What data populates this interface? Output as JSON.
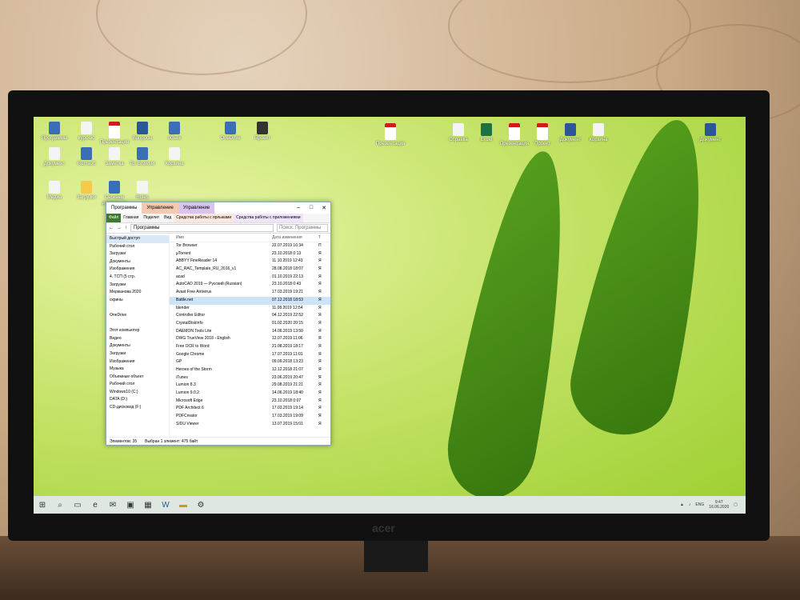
{
  "desktop_icons": [
    {
      "label": "Программы",
      "icon": "app-icon"
    },
    {
      "label": "курс-ас",
      "icon": "doc-icon"
    },
    {
      "label": "Презентация",
      "icon": "pdf-icon"
    },
    {
      "label": "Вопросы",
      "icon": "word-icon"
    },
    {
      "label": "объек",
      "icon": "app-icon"
    },
    {
      "label": "OneDrive",
      "icon": "app-icon"
    },
    {
      "label": "Проект",
      "icon": "dark-icon"
    },
    {
      "label": "Документ",
      "icon": "doc-icon"
    },
    {
      "label": "Remsoft",
      "icon": "app-icon"
    },
    {
      "label": "Заметка",
      "icon": "doc-icon"
    },
    {
      "label": "Tor Browser",
      "icon": "app-icon"
    },
    {
      "label": "Корзина",
      "icon": "doc-icon"
    },
    {
      "label": "Медиа",
      "icon": "doc-icon"
    },
    {
      "label": "Загрузки",
      "icon": "folder-icon"
    },
    {
      "label": "Сетевые документы",
      "icon": "app-icon"
    },
    {
      "label": "Rules",
      "icon": "doc-icon"
    },
    {
      "label": "Презентация",
      "icon": "pdf-icon"
    },
    {
      "label": "Документ",
      "icon": "word-icon"
    },
    {
      "label": "Excel",
      "icon": "excel-icon"
    },
    {
      "label": "Презентация",
      "icon": "pdf-icon"
    },
    {
      "label": "Проект",
      "icon": "pdf-icon"
    },
    {
      "label": "Документ",
      "icon": "word-icon"
    },
    {
      "label": "Корзина",
      "icon": "doc-icon"
    },
    {
      "label": "Справка",
      "icon": "doc-icon"
    }
  ],
  "explorer": {
    "title": "Программы",
    "context_tab_manage": "Управление",
    "context_tab_manage2": "Управление",
    "ribbon": [
      "Файл",
      "Главная",
      "Поделит",
      "Вид",
      "Средства работы с ярлыками",
      "Средства работы с приложениями"
    ],
    "path": "Программы",
    "search_placeholder": "Поиск: Программы",
    "column_name": "Имя",
    "column_date": "Дата изменения",
    "column_type": "Т",
    "nav": [
      {
        "label": "Быстрый доступ",
        "selected": true
      },
      {
        "label": "Рабочий стол"
      },
      {
        "label": "Загрузки"
      },
      {
        "label": "Документы"
      },
      {
        "label": "Изображения"
      },
      {
        "label": "4. ТСП (5 стр."
      },
      {
        "label": "Загрузки"
      },
      {
        "label": "Мержанова 2020"
      },
      {
        "label": "скрины"
      },
      {
        "label": ""
      },
      {
        "label": "OneDrive"
      },
      {
        "label": ""
      },
      {
        "label": "Этот компьютер"
      },
      {
        "label": "Видео"
      },
      {
        "label": "Документы"
      },
      {
        "label": "Загрузки"
      },
      {
        "label": "Изображения"
      },
      {
        "label": "Музыка"
      },
      {
        "label": "Объемные объект"
      },
      {
        "label": "Рабочий стол"
      },
      {
        "label": "Windows10 (C:)"
      },
      {
        "label": "DATA (D:)"
      },
      {
        "label": "CD-дисковод (F:)"
      }
    ],
    "files": [
      {
        "name": "Tor Browser",
        "date": "22.07.2019 16:34",
        "type": "П"
      },
      {
        "name": "µTorrent",
        "date": "23.10.2018 0:13",
        "type": "Я"
      },
      {
        "name": "ABBYY FineReader 14",
        "date": "11.10.2019 12:43",
        "type": "Я"
      },
      {
        "name": "AC_RAC_Template_RU_2016_v1",
        "date": "28.08.2018 18:07",
        "type": "Я"
      },
      {
        "name": "acad",
        "date": "01.10.2019 22:13",
        "type": "Я"
      },
      {
        "name": "AutoCAD 2019 — Русский (Russian)",
        "date": "23.10.2018 0:43",
        "type": "Я"
      },
      {
        "name": "Avast Free Antivirus",
        "date": "17.03.2019 19:21",
        "type": "Я"
      },
      {
        "name": "Battle.net",
        "date": "07.12.2018 18:53",
        "type": "Я",
        "selected": true
      },
      {
        "name": "blender",
        "date": "11.08.2019 12:54",
        "type": "Я"
      },
      {
        "name": "Controller Editor",
        "date": "04.12.2019 22:52",
        "type": "Я"
      },
      {
        "name": "CrystalDiskInfo",
        "date": "01.02.2020 20:15",
        "type": "Я"
      },
      {
        "name": "DAEMON Tools Lite",
        "date": "14.06.2019 13:50",
        "type": "Я"
      },
      {
        "name": "DWG TrueView 2018 - English",
        "date": "12.07.2019 11:06",
        "type": "Я"
      },
      {
        "name": "Free OCR to Word",
        "date": "21.08.2019 18:17",
        "type": "Я"
      },
      {
        "name": "Google Chrome",
        "date": "17.07.2019 11:01",
        "type": "Я"
      },
      {
        "name": "GP",
        "date": "09.09.2018 13:23",
        "type": "Я"
      },
      {
        "name": "Heroes of the Storm",
        "date": "12.12.2018 21:07",
        "type": "Я"
      },
      {
        "name": "iTunes",
        "date": "23.06.2019 20:47",
        "type": "Я"
      },
      {
        "name": "Lumion 8.3",
        "date": "29.08.2019 21:21",
        "type": "Я"
      },
      {
        "name": "Lumion 9.0.2",
        "date": "14.06.2019 18:40",
        "type": "Я"
      },
      {
        "name": "Microsoft Edge",
        "date": "23.10.2018 0:07",
        "type": "Я"
      },
      {
        "name": "PDF Architect 6",
        "date": "17.03.2019 19:14",
        "type": "Я"
      },
      {
        "name": "PDFCreator",
        "date": "17.03.2019 19:09",
        "type": "Я"
      },
      {
        "name": "SIDU Viewer",
        "date": "13.07.2019 15:01",
        "type": "Я"
      }
    ],
    "status_count": "Элементов: 35",
    "status_selected": "Выбран 1 элемент: 475 байт"
  },
  "tray": {
    "lang": "ENG",
    "time": "9:47",
    "date": "16.06.2020"
  },
  "monitor_brand": "acer"
}
